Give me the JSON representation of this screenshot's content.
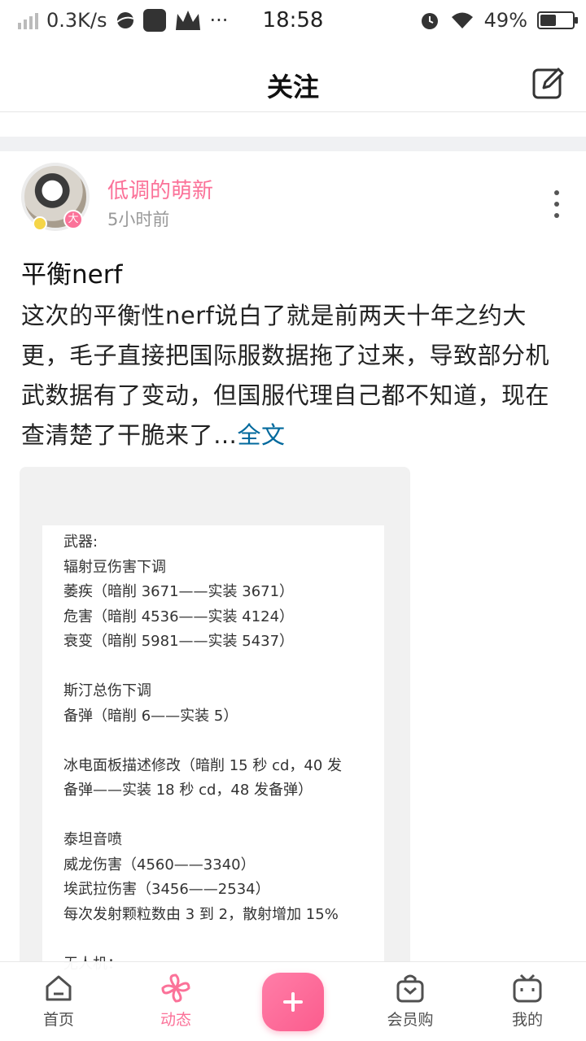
{
  "status_bar": {
    "net_speed": "0.3K/s",
    "time": "18:58",
    "battery": "49%",
    "battery_level": 0.49,
    "more": "···"
  },
  "header": {
    "title": "关注"
  },
  "post": {
    "username": "低调的萌新",
    "time": "5小时前",
    "badge": "大",
    "title": "平衡nerf",
    "body": "这次的平衡性nerf说白了就是前两天十年之约大更，毛子直接把国际服数据拖了过来，导致部分机武数据有了变动，但国服代理自己都不知道，现在查清楚了干脆来了…",
    "full_text_link": "全文",
    "image_lines": [
      "武器:",
      "辐射豆伤害下调",
      "萎疾（暗削 3671——实装 3671）",
      "危害（暗削 4536——实装 4124）",
      "衰变（暗削 5981——实装 5437）",
      "",
      "斯汀总伤下调",
      "备弹（暗削 6——实装 5）",
      "",
      "冰电面板描述修改（暗削 15 秒 cd，40 发",
      "备弹——实装 18 秒 cd，48 发备弹）",
      "",
      "泰坦音喷",
      "威龙伤害（4560——3340）",
      "埃武拉伤害（3456——2534）",
      "每次发射颗粒数由 3 到 2，散射增加 15%",
      "",
      "无人机："
    ]
  },
  "bottom_nav": {
    "items": [
      {
        "label": "首页"
      },
      {
        "label": "动态"
      },
      {
        "label": "会员购"
      },
      {
        "label": "我的"
      }
    ]
  },
  "colors": {
    "accent": "#fb7299",
    "link": "#00699d"
  }
}
